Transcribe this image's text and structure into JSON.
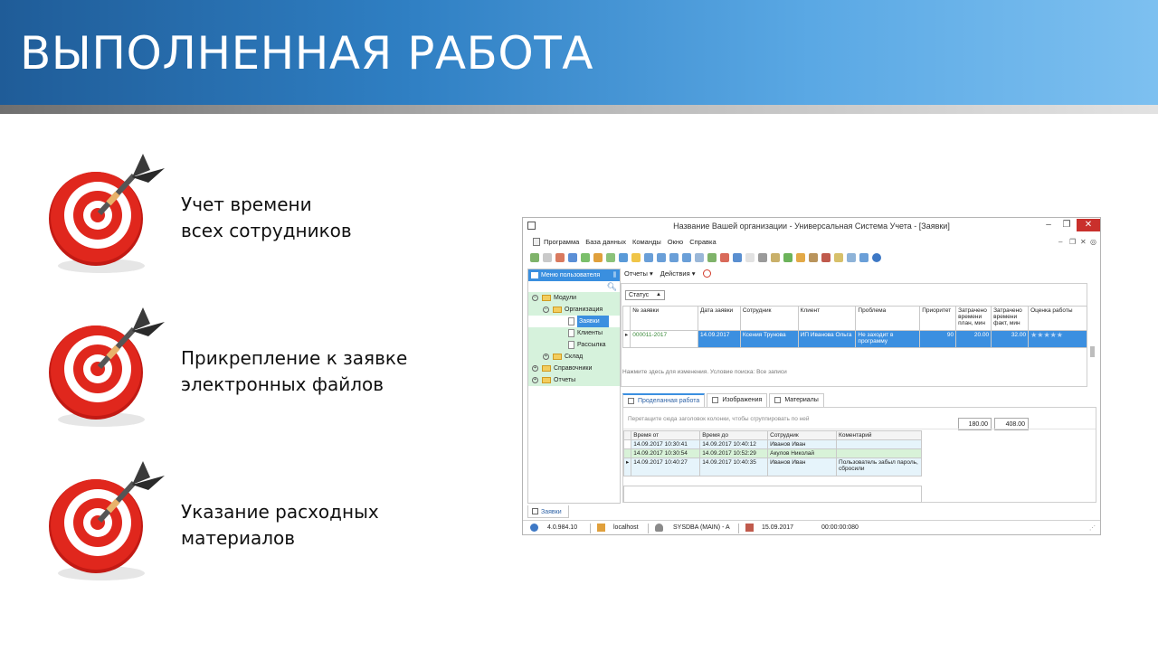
{
  "slide": {
    "title": "ВЫПОЛНЕННАЯ РАБОТА",
    "features": [
      {
        "line1": "Учет времени",
        "line2": "всех сотрудников"
      },
      {
        "line1": "Прикрепление к заявке",
        "line2": "электронных файлов"
      },
      {
        "line1": "Указание расходных",
        "line2": "материалов"
      }
    ]
  },
  "app": {
    "window_title": "Название Вашей организации - Универсальная Система Учета - [Заявки]",
    "menu": [
      "Программа",
      "База данных",
      "Команды",
      "Окно",
      "Справка"
    ],
    "sidebar": {
      "header": "Меню пользователя",
      "tree": [
        {
          "label": "Модули",
          "level": 0,
          "kind": "folder",
          "expander": "−"
        },
        {
          "label": "Организация",
          "level": 1,
          "kind": "folder",
          "expander": "−"
        },
        {
          "label": "Заявки",
          "level": 2,
          "kind": "doc",
          "selected": true
        },
        {
          "label": "Клиенты",
          "level": 2,
          "kind": "doc"
        },
        {
          "label": "Рассылка",
          "level": 2,
          "kind": "doc"
        },
        {
          "label": "Склад",
          "level": 1,
          "kind": "folder",
          "expander": "+"
        },
        {
          "label": "Справочники",
          "level": 0,
          "kind": "folder",
          "expander": "+"
        },
        {
          "label": "Отчеты",
          "level": 0,
          "kind": "folder",
          "expander": "+"
        }
      ],
      "bottom_tab": "Заявки"
    },
    "subtoolbar": {
      "reports": "Отчеты ▾",
      "actions": "Действия ▾"
    },
    "status_filter": "Статус",
    "grid": {
      "columns": [
        "№ заявки",
        "Дата заявки",
        "Сотрудник",
        "Клиент",
        "Проблема",
        "Приоритет",
        "Затрачено времени план, мин",
        "Затрачено времени факт, мин",
        "Оценка работы"
      ],
      "row": {
        "number": "000011-2017",
        "date": "14.09.2017",
        "employee": "Ксения Трунова",
        "client": "ИП Иванова Ольга",
        "problem": "Не заходит в программу",
        "priority": "90",
        "plan": "20.00",
        "fact": "32.00",
        "rating": "★★★★★"
      },
      "totals": {
        "plan": "180.00",
        "fact": "408.00"
      },
      "filter_hint": "Нажмите здесь для изменения. Условие поиска: Все записи"
    },
    "tabs": [
      "Проделанная работа",
      "Изображения",
      "Материалы"
    ],
    "detail": {
      "group_hint": "Перетащите сюда заголовок колонки, чтобы сгруппировать по ней",
      "columns": [
        "Время от",
        "Время до",
        "Сотрудник",
        "Коментарий"
      ],
      "rows": [
        {
          "from": "14.09.2017 10:30:41",
          "to": "14.09.2017 10:40:12",
          "employee": "Иванов Иван",
          "comment": ""
        },
        {
          "from": "14.09.2017 10:30:54",
          "to": "14.09.2017 10:52:29",
          "employee": "Акулов Николай",
          "comment": ""
        },
        {
          "from": "14.09.2017 10:40:27",
          "to": "14.09.2017 10:40:35",
          "employee": "Иванов Иван",
          "comment": "Пользователь забыл пароль, сбросили"
        }
      ]
    },
    "statusbar": {
      "version": "4.0.984.10",
      "server": "localhost",
      "user": "SYSDBA (MAIN) - A",
      "date": "15.09.2017",
      "timer": "00:00:00:080"
    }
  },
  "colors": {
    "accent": "#3b8fe0",
    "target_red": "#d9241b",
    "tree_bg": "#d6f2dc"
  }
}
